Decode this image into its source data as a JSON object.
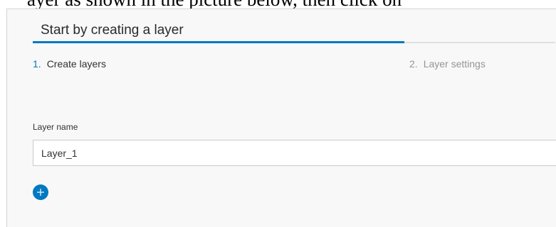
{
  "caption": {
    "text": "ayer as shown in the picture below, then click on"
  },
  "dialog": {
    "title": "Start by creating a layer",
    "steps": [
      {
        "number": "1.",
        "label": "Create layers",
        "state": "active"
      },
      {
        "number": "2.",
        "label": "Layer settings",
        "state": "inactive"
      }
    ],
    "progress_fraction": 0.5,
    "layer_name_label": "Layer name",
    "layer_name_value": "Layer_1",
    "add_layer_icon": "plus-icon"
  },
  "colors": {
    "accent": "#0079c1",
    "inactive_text": "#959595",
    "dialog_background": "#f8f8f8"
  }
}
